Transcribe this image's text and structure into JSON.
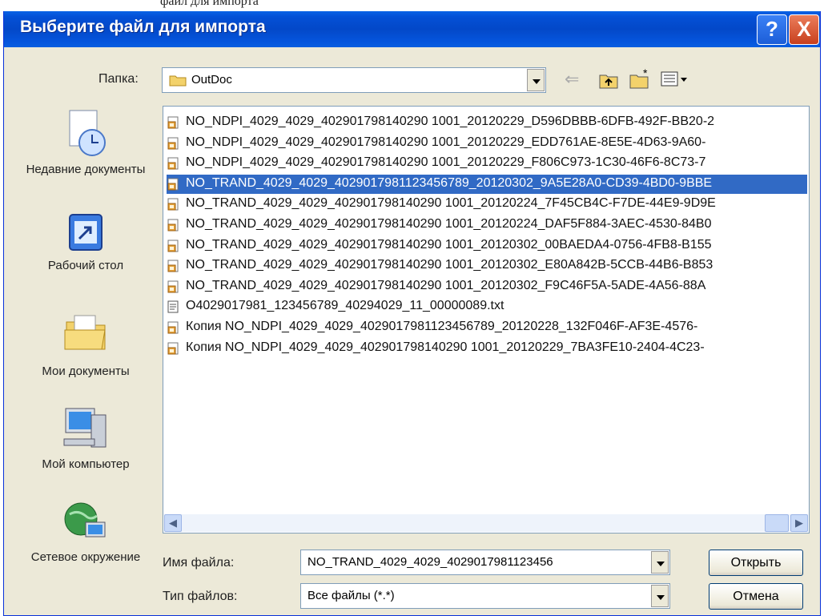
{
  "window": {
    "title": "Выберите файл для импорта",
    "help_label": "?",
    "close_label": "X"
  },
  "doc_top_text": "файл для импорта",
  "folder_bar": {
    "label": "Папка:",
    "value": "OutDoc",
    "icons": [
      "back-arrow-icon",
      "up-folder-icon",
      "new-folder-icon",
      "view-menu-icon"
    ]
  },
  "places": [
    {
      "label": "Недавние документы",
      "icon": "recent-documents-icon"
    },
    {
      "label": "Рабочий стол",
      "icon": "desktop-icon"
    },
    {
      "label": "Мои документы",
      "icon": "my-documents-icon"
    },
    {
      "label": "Мой компьютер",
      "icon": "my-computer-icon"
    },
    {
      "label": "Сетевое окружение",
      "icon": "network-icon"
    }
  ],
  "files": [
    {
      "name": "NO_NDPI_4029_4029_402901798140290 1001_20120229_D596DBBB-6DFB-492F-BB20-2",
      "icon": "xml-file-icon",
      "selected": false
    },
    {
      "name": "NO_NDPI_4029_4029_402901798140290 1001_20120229_EDD761AE-8E5E-4D63-9A60-",
      "icon": "xml-file-icon",
      "selected": false
    },
    {
      "name": "NO_NDPI_4029_4029_402901798140290 1001_20120229_F806C973-1C30-46F6-8C73-7",
      "icon": "xml-file-icon",
      "selected": false
    },
    {
      "name": "NO_TRAND_4029_4029_4029017981123456789_20120302_9A5E28A0-CD39-4BD0-9BBE",
      "icon": "xml-file-icon",
      "selected": true
    },
    {
      "name": "NO_TRAND_4029_4029_402901798140290 1001_20120224_7F45CB4C-F7DE-44E9-9D9E",
      "icon": "xml-file-icon",
      "selected": false
    },
    {
      "name": "NO_TRAND_4029_4029_402901798140290 1001_20120224_DAF5F884-3AEC-4530-84B0",
      "icon": "xml-file-icon",
      "selected": false
    },
    {
      "name": "NO_TRAND_4029_4029_402901798140290 1001_20120302_00BAEDA4-0756-4FB8-B155",
      "icon": "xml-file-icon",
      "selected": false
    },
    {
      "name": "NO_TRAND_4029_4029_402901798140290 1001_20120302_E80A842B-5CCB-44B6-B853",
      "icon": "xml-file-icon",
      "selected": false
    },
    {
      "name": "NO_TRAND_4029_4029_402901798140290 1001_20120302_F9C46F5A-5ADE-4A56-88A",
      "icon": "xml-file-icon",
      "selected": false
    },
    {
      "name": "O4029017981_123456789_40294029_11_00000089.txt",
      "icon": "text-file-icon",
      "selected": false
    },
    {
      "name": "Копия NO_NDPI_4029_4029_4029017981123456789_20120228_132F046F-AF3E-4576-",
      "icon": "xml-file-icon",
      "selected": false
    },
    {
      "name": "Копия NO_NDPI_4029_4029_402901798140290 1001_20120229_7BA3FE10-2404-4C23-",
      "icon": "xml-file-icon",
      "selected": false
    }
  ],
  "filename": {
    "label": "Имя файла:",
    "value": "NO_TRAND_4029_4029_4029017981123456"
  },
  "filetype": {
    "label": "Тип файлов:",
    "value": "Все файлы (*.*)"
  },
  "buttons": {
    "open": "Открыть",
    "cancel": "Отмена"
  },
  "colors": {
    "titlebar": "#0450d6",
    "selection": "#316ac5",
    "dialog_bg": "#ece9d8"
  }
}
